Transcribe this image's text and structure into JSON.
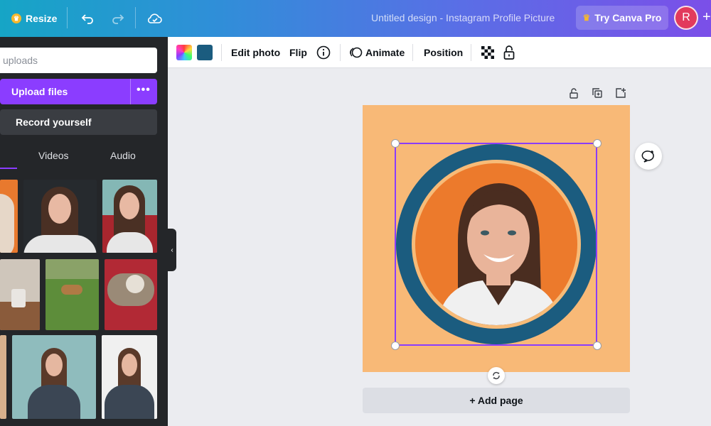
{
  "topbar": {
    "resize_label": "Resize",
    "doc_title": "Untitled design - Instagram Profile Picture",
    "try_pro_label": "Try Canva Pro",
    "avatar_initial": "R",
    "plus": "+"
  },
  "panel": {
    "search_placeholder": "uploads",
    "upload_label": "Upload files",
    "more_label": "•••",
    "record_label": "Record yourself",
    "tabs": [
      "Videos",
      "Audio"
    ]
  },
  "toolbar": {
    "edit_photo": "Edit photo",
    "flip": "Flip",
    "animate": "Animate",
    "position": "Position",
    "color_swatch": "#1b5c7f"
  },
  "canvas": {
    "background_color": "#f8b977",
    "ring_color": "#1b5c7f",
    "photo_bg_color": "#ec7a2c",
    "add_page_label": "+ Add page"
  }
}
